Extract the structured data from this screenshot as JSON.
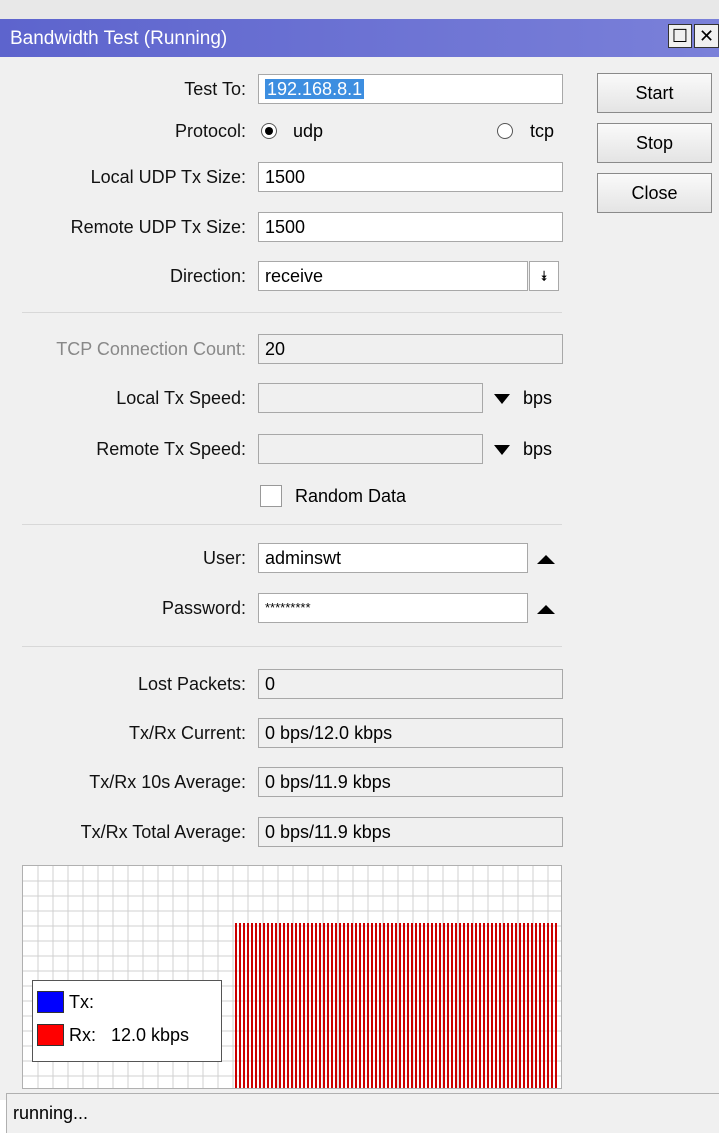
{
  "window": {
    "title": "Bandwidth Test (Running)",
    "restore_glyph": "☐",
    "close_glyph": "✕"
  },
  "buttons": {
    "start": "Start",
    "stop": "Stop",
    "close": "Close"
  },
  "form": {
    "test_to": {
      "label": "Test To:",
      "value": "192.168.8.1"
    },
    "protocol": {
      "label": "Protocol:",
      "options": [
        "udp",
        "tcp"
      ],
      "selected": "udp"
    },
    "local_udp_tx_size": {
      "label": "Local UDP Tx Size:",
      "value": "1500"
    },
    "remote_udp_tx_size": {
      "label": "Remote UDP Tx Size:",
      "value": "1500"
    },
    "direction": {
      "label": "Direction:",
      "value": "receive"
    },
    "tcp_connection_count": {
      "label": "TCP Connection Count:",
      "value": "20"
    },
    "local_tx_speed": {
      "label": "Local Tx Speed:",
      "value": "",
      "unit": "bps"
    },
    "remote_tx_speed": {
      "label": "Remote Tx Speed:",
      "value": "",
      "unit": "bps"
    },
    "random_data": {
      "label": "Random Data",
      "checked": false
    },
    "user": {
      "label": "User:",
      "value": "adminswt"
    },
    "password": {
      "label": "Password:",
      "value": "*********"
    }
  },
  "results": {
    "lost_packets": {
      "label": "Lost Packets:",
      "value": "0"
    },
    "txrx_current": {
      "label": "Tx/Rx Current:",
      "value": "0 bps/12.0 kbps"
    },
    "txrx_10s_average": {
      "label": "Tx/Rx 10s Average:",
      "value": "0 bps/11.9 kbps"
    },
    "txrx_total_average": {
      "label": "Tx/Rx Total Average:",
      "value": "0 bps/11.9 kbps"
    }
  },
  "graph": {
    "legend": [
      {
        "name": "Tx:",
        "value": "",
        "color": "#0000ff"
      },
      {
        "name": "Rx:",
        "value": "12.0 kbps",
        "color": "#ff0000"
      }
    ],
    "bar_color": "#cc0000",
    "grid_color": "#d0d0d0"
  },
  "status": {
    "text": "running..."
  }
}
